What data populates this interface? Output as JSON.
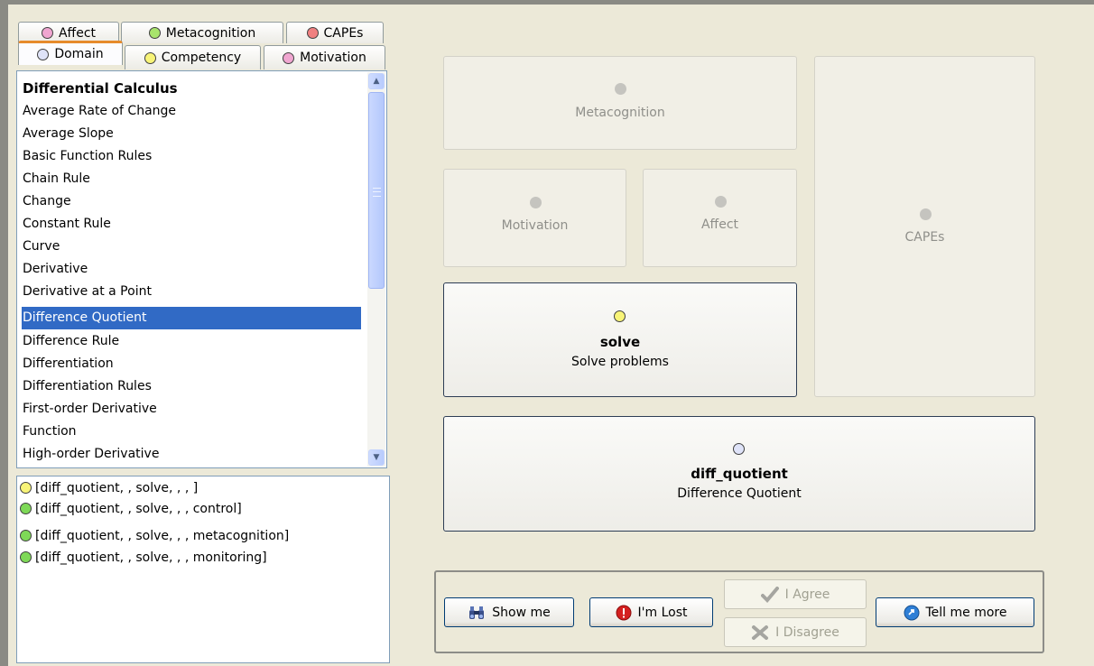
{
  "tabs_top": [
    {
      "label": "Affect",
      "dot_color": "#f0a6d0"
    },
    {
      "label": "Metacognition",
      "dot_color": "#a8e46c"
    },
    {
      "label": "CAPEs",
      "dot_color": "#f08080"
    }
  ],
  "tabs_bottom": [
    {
      "label": "Domain",
      "dot_color": "#dfe3f8",
      "active": true
    },
    {
      "label": "Competency",
      "dot_color": "#f8f478"
    },
    {
      "label": "Motivation",
      "dot_color": "#f0a6d0"
    }
  ],
  "domain_list": {
    "items": [
      "Differential Calculus",
      "Average Rate of Change",
      "Average Slope",
      "Basic Function Rules",
      "Chain Rule",
      "Change",
      "Constant Rule",
      "Curve",
      "Derivative",
      "Derivative at a Point",
      "Difference Quotient",
      "Difference Rule",
      "Differentiation",
      "Differentiation Rules",
      "First-order Derivative",
      "Function",
      "High-order Derivative"
    ],
    "selected": "Difference Quotient"
  },
  "results": [
    {
      "text": "[diff_quotient, , solve, , , ]",
      "dot_color": "#f8f478"
    },
    {
      "text": "[diff_quotient, , solve, , , control]",
      "dot_color": "#7ed957"
    },
    {
      "text": "[diff_quotient, , solve, , , metacognition]",
      "dot_color": "#7ed957"
    },
    {
      "text": "[diff_quotient, , solve, , , monitoring]",
      "dot_color": "#7ed957"
    }
  ],
  "panels": {
    "metacognition": "Metacognition",
    "motivation": "Motivation",
    "affect": "Affect",
    "capes": "CAPEs",
    "competency": {
      "code": "solve",
      "description": "Solve problems",
      "dot_color": "#f8f478"
    },
    "domain": {
      "code": "diff_quotient",
      "description": "Difference Quotient",
      "dot_color": "#dfe3f8"
    }
  },
  "buttons": {
    "show_me": "Show me",
    "im_lost": "I'm Lost",
    "i_agree": "I Agree",
    "i_disagree": "I Disagree",
    "tell_me_more": "Tell me more"
  }
}
